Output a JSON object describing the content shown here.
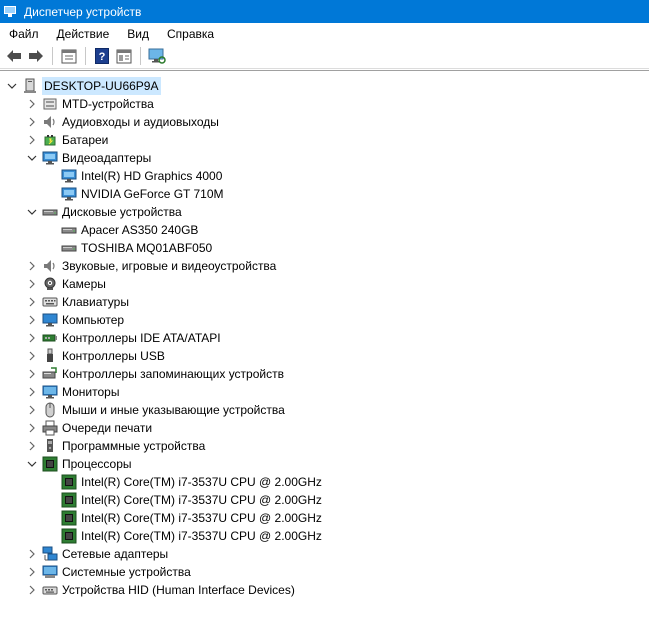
{
  "window": {
    "title": "Диспетчер устройств"
  },
  "menu": [
    "Файл",
    "Действие",
    "Вид",
    "Справка"
  ],
  "toolbar": {
    "buttons": [
      "back-arrow-icon",
      "forward-arrow-icon",
      "properties-icon",
      "help-icon",
      "view-icon",
      "monitor-scan-icon"
    ]
  },
  "tree": {
    "root": "DESKTOP-UU66P9A",
    "items": [
      {
        "label": "MTD-устройства",
        "expanded": false,
        "icon": "mtd-icon"
      },
      {
        "label": "Аудиовходы и аудиовыходы",
        "expanded": false,
        "icon": "speaker-icon"
      },
      {
        "label": "Батареи",
        "expanded": false,
        "icon": "battery-icon"
      },
      {
        "label": "Видеоадаптеры",
        "expanded": true,
        "icon": "display-adapter-icon",
        "children": [
          "Intel(R) HD Graphics 4000",
          "NVIDIA GeForce GT 710M"
        ]
      },
      {
        "label": "Дисковые устройства",
        "expanded": true,
        "icon": "disk-icon",
        "children": [
          "Apacer AS350 240GB",
          "TOSHIBA MQ01ABF050"
        ]
      },
      {
        "label": "Звуковые, игровые и видеоустройства",
        "expanded": false,
        "icon": "speaker-icon"
      },
      {
        "label": "Камеры",
        "expanded": false,
        "icon": "camera-icon"
      },
      {
        "label": "Клавиатуры",
        "expanded": false,
        "icon": "keyboard-icon"
      },
      {
        "label": "Компьютер",
        "expanded": false,
        "icon": "computer-icon"
      },
      {
        "label": "Контроллеры IDE ATA/ATAPI",
        "expanded": false,
        "icon": "ide-controller-icon"
      },
      {
        "label": "Контроллеры USB",
        "expanded": false,
        "icon": "usb-icon"
      },
      {
        "label": "Контроллеры запоминающих устройств",
        "expanded": false,
        "icon": "storage-controller-icon"
      },
      {
        "label": "Мониторы",
        "expanded": false,
        "icon": "monitor-icon"
      },
      {
        "label": "Мыши и иные указывающие устройства",
        "expanded": false,
        "icon": "mouse-icon"
      },
      {
        "label": "Очереди печати",
        "expanded": false,
        "icon": "printer-icon"
      },
      {
        "label": "Программные устройства",
        "expanded": false,
        "icon": "software-device-icon"
      },
      {
        "label": "Процессоры",
        "expanded": true,
        "icon": "cpu-icon",
        "children": [
          "Intel(R) Core(TM) i7-3537U CPU @ 2.00GHz",
          "Intel(R) Core(TM) i7-3537U CPU @ 2.00GHz",
          "Intel(R) Core(TM) i7-3537U CPU @ 2.00GHz",
          "Intel(R) Core(TM) i7-3537U CPU @ 2.00GHz"
        ]
      },
      {
        "label": "Сетевые адаптеры",
        "expanded": false,
        "icon": "network-adapter-icon"
      },
      {
        "label": "Системные устройства",
        "expanded": false,
        "icon": "system-device-icon"
      },
      {
        "label": "Устройства HID (Human Interface Devices)",
        "expanded": false,
        "icon": "hid-icon"
      }
    ]
  },
  "colors": {
    "titlebar": "#0078d7",
    "selection": "#cce8ff"
  }
}
